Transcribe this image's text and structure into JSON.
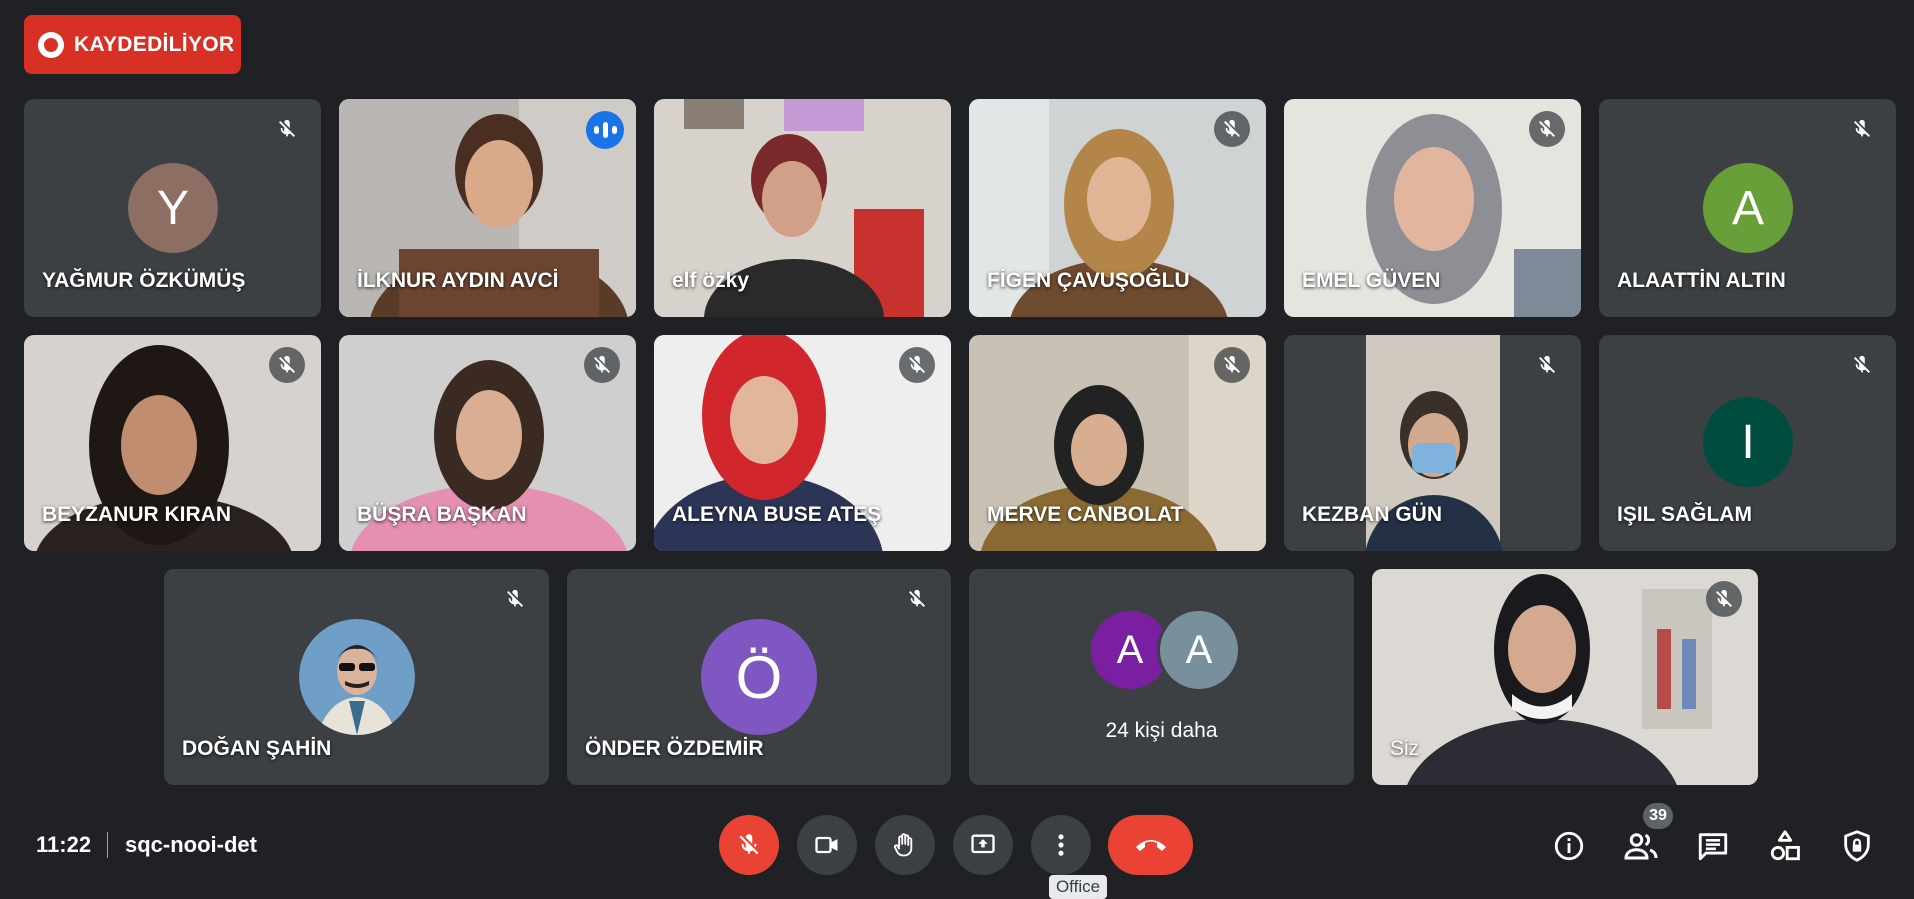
{
  "recording": {
    "label": "KAYDEDİLİYOR"
  },
  "tiles": {
    "t1": {
      "name": "YAĞMUR ÖZKÜMÜŞ",
      "initial": "Y",
      "color": "#8d6e63"
    },
    "t2": {
      "name": "İLKNUR AYDIN AVCİ"
    },
    "t3": {
      "name": "elf özky"
    },
    "t4": {
      "name": "FİGEN ÇAVUŞOĞLU"
    },
    "t5": {
      "name": "EMEL GÜVEN"
    },
    "t6": {
      "name": "ALAATTİN ALTIN",
      "initial": "A",
      "color": "#689f38"
    },
    "t7": {
      "name": "BEYZANUR KIRAN"
    },
    "t8": {
      "name": "BÜŞRA BAŞKAN"
    },
    "t9": {
      "name": "ALEYNA BUSE ATEŞ"
    },
    "t10": {
      "name": "MERVE CANBOLAT"
    },
    "t11": {
      "name": "KEZBAN GÜN"
    },
    "t12": {
      "name": "IŞIL SAĞLAM",
      "initial": "I",
      "color": "#004d40"
    },
    "t13": {
      "name": "DOĞAN ŞAHİN"
    },
    "t14": {
      "name": "ÖNDER ÖZDEMİR",
      "initial": "Ö",
      "color": "#7e57c2"
    },
    "t15": {
      "more_label": "24 kişi daha",
      "initial_a": "A",
      "initial_b": "A",
      "color_a": "#7b1fa2",
      "color_b": "#78909c"
    },
    "t16": {
      "name": "Siz"
    }
  },
  "bottom_bar": {
    "time": "11:22",
    "meeting_code": "sqc-nooi-det",
    "tooltip": "Office",
    "participant_count": "39"
  },
  "icons": {
    "mic_off": "mic-off-icon",
    "camera": "camera-icon",
    "hand": "raise-hand-icon",
    "present": "present-screen-icon",
    "more": "more-options-icon",
    "hangup": "hang-up-icon",
    "info": "info-icon",
    "people": "people-icon",
    "chat": "chat-icon",
    "activities": "activities-icon",
    "host_controls": "host-controls-icon"
  },
  "colors": {
    "accent": "#8ab4f8",
    "record_red": "#d93025",
    "hangup_red": "#ea4335",
    "background": "#202124",
    "tile": "#3c4043"
  }
}
